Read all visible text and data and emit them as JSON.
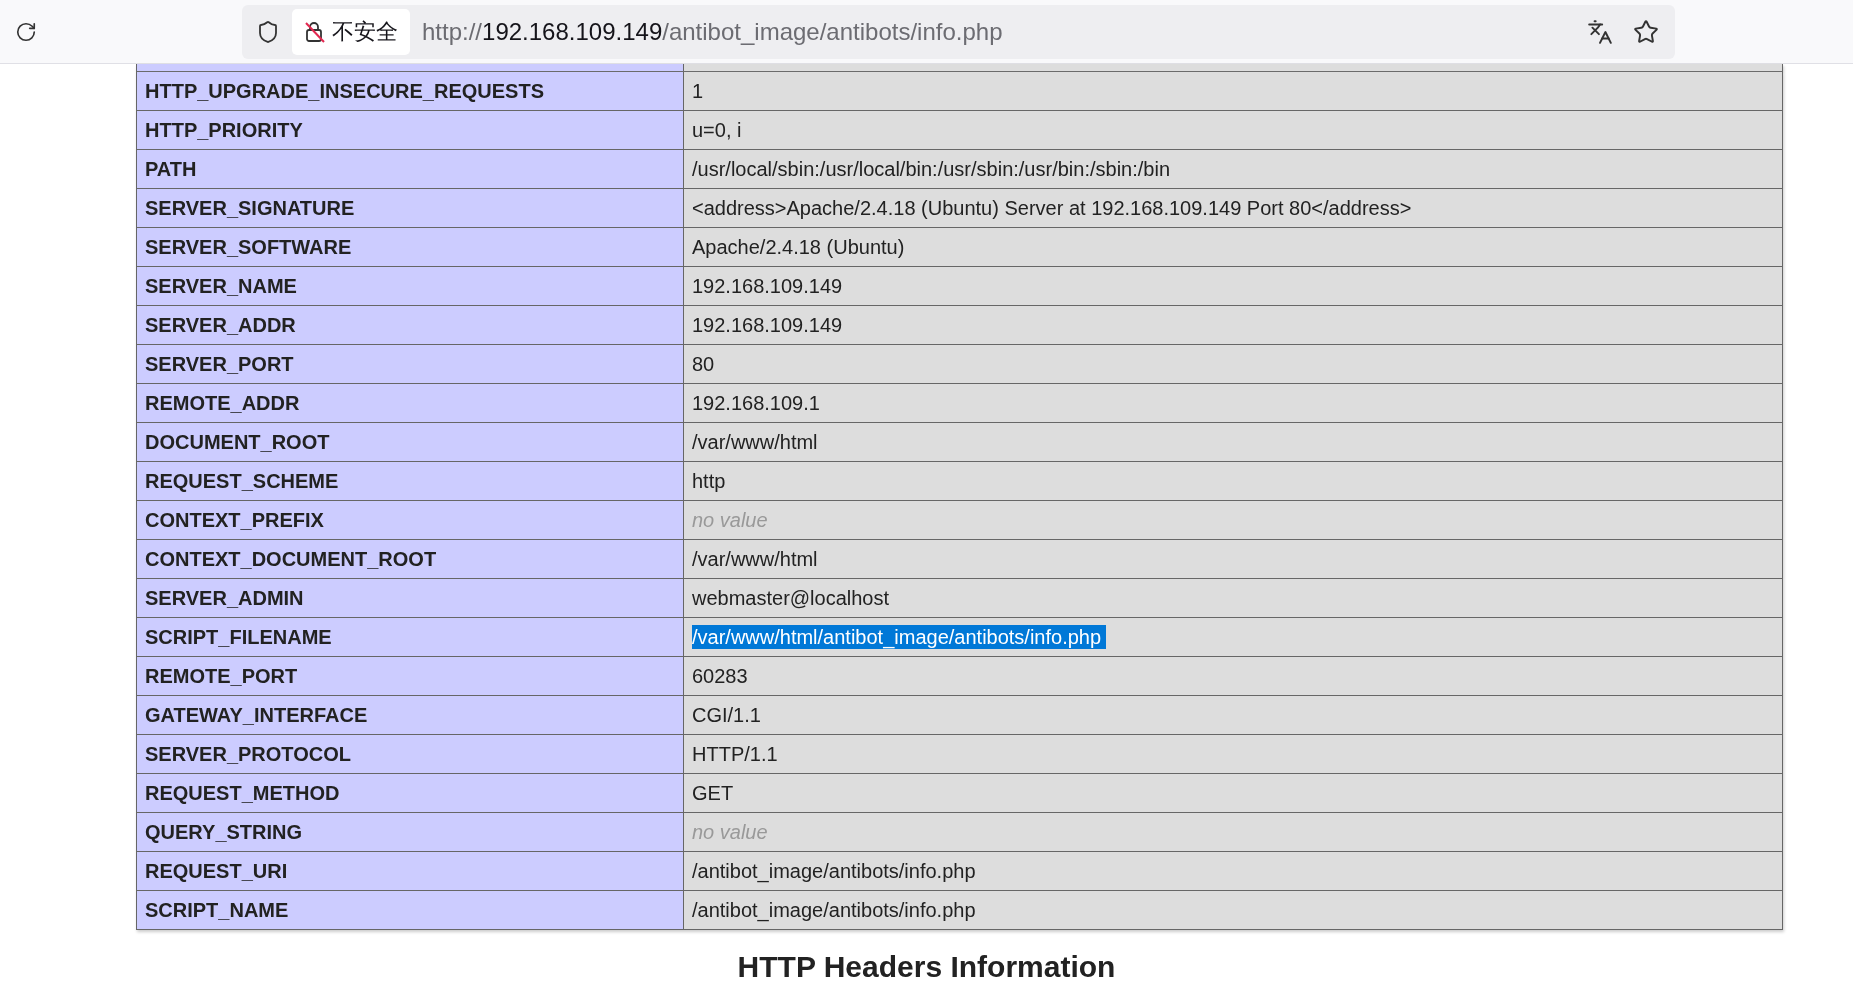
{
  "browser": {
    "security_label": "不安全",
    "url": {
      "scheme": "http://",
      "host": "192.168.109.149",
      "path": "/antibot_image/antibots/info.php"
    }
  },
  "table": {
    "rows": [
      {
        "key": "HTTP_UPGRADE_INSECURE_REQUESTS",
        "value": "1",
        "kind": "text",
        "selected": false
      },
      {
        "key": "HTTP_PRIORITY",
        "value": "u=0, i",
        "kind": "text",
        "selected": false
      },
      {
        "key": "PATH",
        "value": "/usr/local/sbin:/usr/local/bin:/usr/sbin:/usr/bin:/sbin:/bin",
        "kind": "text",
        "selected": false
      },
      {
        "key": "SERVER_SIGNATURE",
        "value": "<address>Apache/2.4.18 (Ubuntu) Server at 192.168.109.149 Port 80</address>",
        "kind": "text",
        "selected": false
      },
      {
        "key": "SERVER_SOFTWARE",
        "value": "Apache/2.4.18 (Ubuntu)",
        "kind": "text",
        "selected": false
      },
      {
        "key": "SERVER_NAME",
        "value": "192.168.109.149",
        "kind": "text",
        "selected": false
      },
      {
        "key": "SERVER_ADDR",
        "value": "192.168.109.149",
        "kind": "text",
        "selected": false
      },
      {
        "key": "SERVER_PORT",
        "value": "80",
        "kind": "text",
        "selected": false
      },
      {
        "key": "REMOTE_ADDR",
        "value": "192.168.109.1",
        "kind": "text",
        "selected": false
      },
      {
        "key": "DOCUMENT_ROOT",
        "value": "/var/www/html",
        "kind": "text",
        "selected": false
      },
      {
        "key": "REQUEST_SCHEME",
        "value": "http",
        "kind": "text",
        "selected": false
      },
      {
        "key": "CONTEXT_PREFIX",
        "value": "no value",
        "kind": "empty",
        "selected": false
      },
      {
        "key": "CONTEXT_DOCUMENT_ROOT",
        "value": "/var/www/html",
        "kind": "text",
        "selected": false
      },
      {
        "key": "SERVER_ADMIN",
        "value": "webmaster@localhost",
        "kind": "text",
        "selected": false
      },
      {
        "key": "SCRIPT_FILENAME",
        "value": "/var/www/html/antibot_image/antibots/info.php",
        "kind": "text",
        "selected": true
      },
      {
        "key": "REMOTE_PORT",
        "value": "60283",
        "kind": "text",
        "selected": false
      },
      {
        "key": "GATEWAY_INTERFACE",
        "value": "CGI/1.1",
        "kind": "text",
        "selected": false
      },
      {
        "key": "SERVER_PROTOCOL",
        "value": "HTTP/1.1",
        "kind": "text",
        "selected": false
      },
      {
        "key": "REQUEST_METHOD",
        "value": "GET",
        "kind": "text",
        "selected": false
      },
      {
        "key": "QUERY_STRING",
        "value": "no value",
        "kind": "empty",
        "selected": false
      },
      {
        "key": "REQUEST_URI",
        "value": "/antibot_image/antibots/info.php",
        "kind": "text",
        "selected": false
      },
      {
        "key": "SCRIPT_NAME",
        "value": "/antibot_image/antibots/info.php",
        "kind": "text",
        "selected": false
      }
    ]
  },
  "section_heading": "HTTP Headers Information"
}
